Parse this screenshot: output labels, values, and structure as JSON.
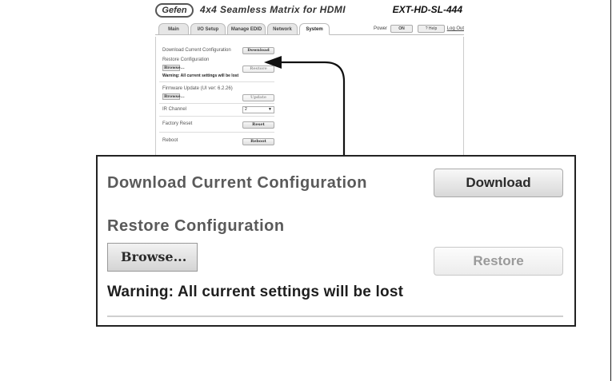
{
  "mini": {
    "logo": "Gefen",
    "title": "4x4 Seamless Matrix for HDMI",
    "model": "EXT-HD-SL-444",
    "tabs": [
      "Main",
      "I/O Setup",
      "Manage EDID",
      "Network",
      "System"
    ],
    "active_tab": "System",
    "power_label": "Power",
    "power_button": "ON",
    "help_button": "? Help",
    "logout": "Log Out",
    "download_config_label": "Download Current Configuration",
    "download_button": "Download",
    "restore_config_label": "Restore Configuration",
    "browse_button": "Browse...",
    "restore_button": "Restore",
    "warning": "Warning: All current settings will be lost",
    "firmware_label": "Firmware Update (UI ver: 6.2.26)",
    "update_button": "Update",
    "ir_channel_label": "IR Channel",
    "ir_channel_value": "2",
    "factory_reset_label": "Factory Reset",
    "reset_button": "Reset",
    "reboot_label": "Reboot",
    "reboot_button": "Reboot"
  },
  "zoom": {
    "download_config_label": "Download Current Configuration",
    "download_button": "Download",
    "restore_config_label": "Restore Configuration",
    "browse_button": "Browse...",
    "restore_button": "Restore",
    "warning": "Warning: All current settings will be lost"
  },
  "colors": {
    "label_gray": "#5a5a5a",
    "disabled_text": "#9a9a9a",
    "border": "#222222"
  }
}
